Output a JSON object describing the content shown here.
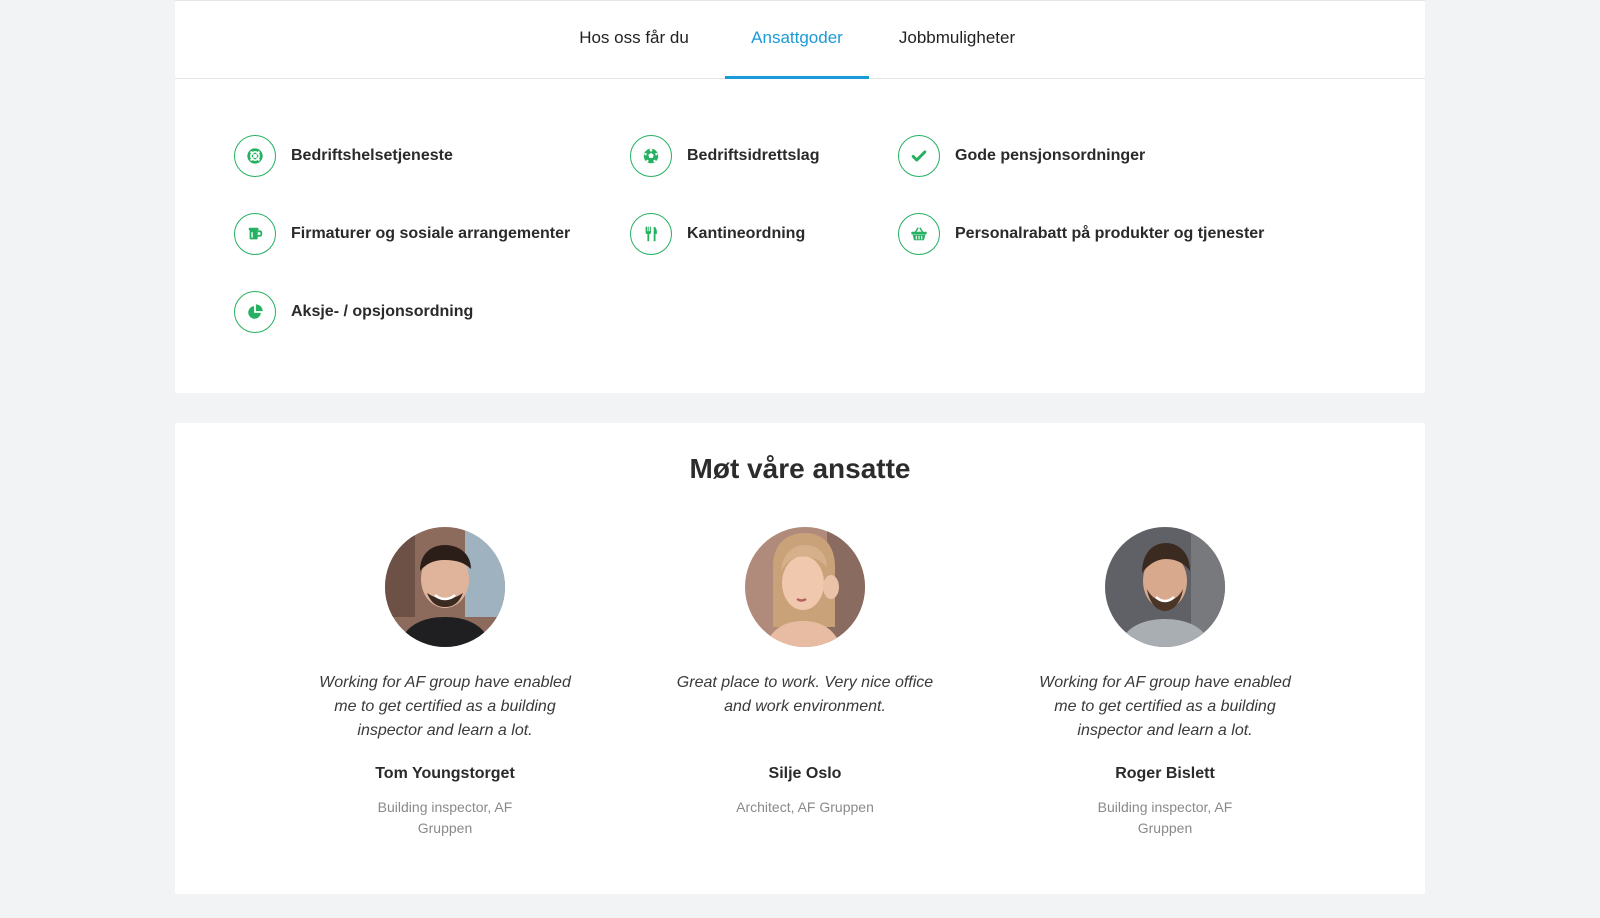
{
  "tabs": [
    {
      "label": "Hos oss får du",
      "active": false
    },
    {
      "label": "Ansattgoder",
      "active": true
    },
    {
      "label": "Jobbmuligheter",
      "active": false
    }
  ],
  "benefits": [
    {
      "label": "Bedriftshelsetjeneste",
      "icon": "life-ring-icon"
    },
    {
      "label": "Bedriftsidrettslag",
      "icon": "soccer-ball-icon"
    },
    {
      "label": "Gode pensjonsordninger",
      "icon": "check-icon"
    },
    {
      "label": "Firmaturer og sosiale arrangementer",
      "icon": "beer-mug-icon"
    },
    {
      "label": "Kantineordning",
      "icon": "cutlery-icon"
    },
    {
      "label": "Personalrabatt på produkter og tjenester",
      "icon": "basket-icon"
    },
    {
      "label": "Aksje- / opsjonsordning",
      "icon": "pie-chart-icon"
    }
  ],
  "people_section": {
    "title": "Møt våre ansatte",
    "people": [
      {
        "quote": "Working for AF group have enabled me to get certified as a building inspector and learn a lot.",
        "name": "Tom Youngstorget",
        "role": "Building inspector, AF Gruppen"
      },
      {
        "quote": "Great place to work. Very nice office and work environment.",
        "name": "Silje Oslo",
        "role": "Architect, AF Gruppen"
      },
      {
        "quote": "Working for AF group have enabled me to get certified as a building inspector and learn a lot.",
        "name": "Roger Bislett",
        "role": "Building inspector, AF Gruppen"
      }
    ]
  },
  "colors": {
    "accent_tab": "#1a9ad6",
    "icon_green": "#25b062",
    "page_bg": "#f2f3f5"
  }
}
